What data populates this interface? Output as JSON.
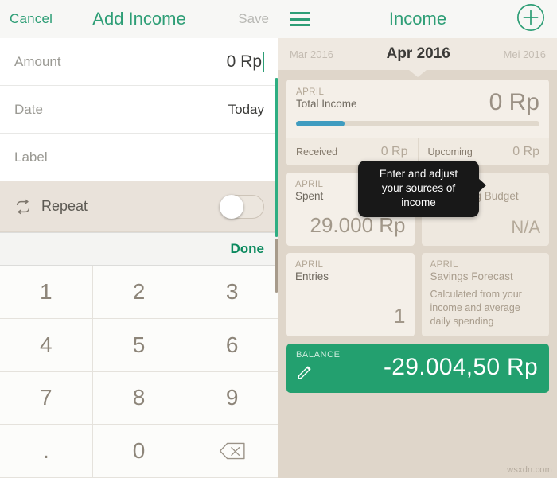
{
  "left": {
    "nav": {
      "cancel_label": "Cancel",
      "title": "Add Income",
      "save_label": "Save"
    },
    "form": {
      "rows": [
        {
          "label": "Amount",
          "value": "0 Rp"
        },
        {
          "label": "Date",
          "value": "Today"
        },
        {
          "label": "Label",
          "value": ""
        }
      ],
      "repeat": {
        "label": "Repeat",
        "toggle_state": "off"
      }
    },
    "keyboard": {
      "done_label": "Done",
      "keys": [
        "1",
        "2",
        "3",
        "4",
        "5",
        "6",
        "7",
        "8",
        "9",
        ".",
        "0",
        "backspace"
      ]
    }
  },
  "right": {
    "nav": {
      "title": "Income"
    },
    "months": {
      "previous": "Mar 2016",
      "current": "Apr 2016",
      "next": "Mei 2016"
    },
    "income_card": {
      "kicker": "APRIL",
      "label": "Total Income",
      "amount": "0 Rp",
      "progress_percent": 20,
      "progress_color": "#3f9cc0",
      "sub": [
        {
          "label": "Received",
          "value": "0 Rp"
        },
        {
          "label": "Upcoming",
          "value": "0 Rp"
        }
      ]
    },
    "stats": [
      {
        "kicker": "APRIL",
        "label": "Spent",
        "value": "29.000 Rp",
        "desc": ""
      },
      {
        "kicker": "APRIL",
        "label": "Remaining Budget",
        "value": "N/A",
        "desc": ""
      },
      {
        "kicker": "APRIL",
        "label": "Entries",
        "value": "1",
        "desc": ""
      },
      {
        "kicker": "APRIL",
        "label": "Savings Forecast",
        "value": "",
        "desc": "Calculated from your income and average daily spending"
      }
    ],
    "balance": {
      "kicker": "BALANCE",
      "amount": "-29.004,50 Rp",
      "color": "#23a06f"
    },
    "tooltip": {
      "text": "Enter and adjust your sources of income"
    }
  },
  "watermark": "wsxdn.com",
  "theme": {
    "accent_green": "#2e9e76",
    "background_beige": "#dfd6ca",
    "card_cream": "#f4efe8"
  }
}
